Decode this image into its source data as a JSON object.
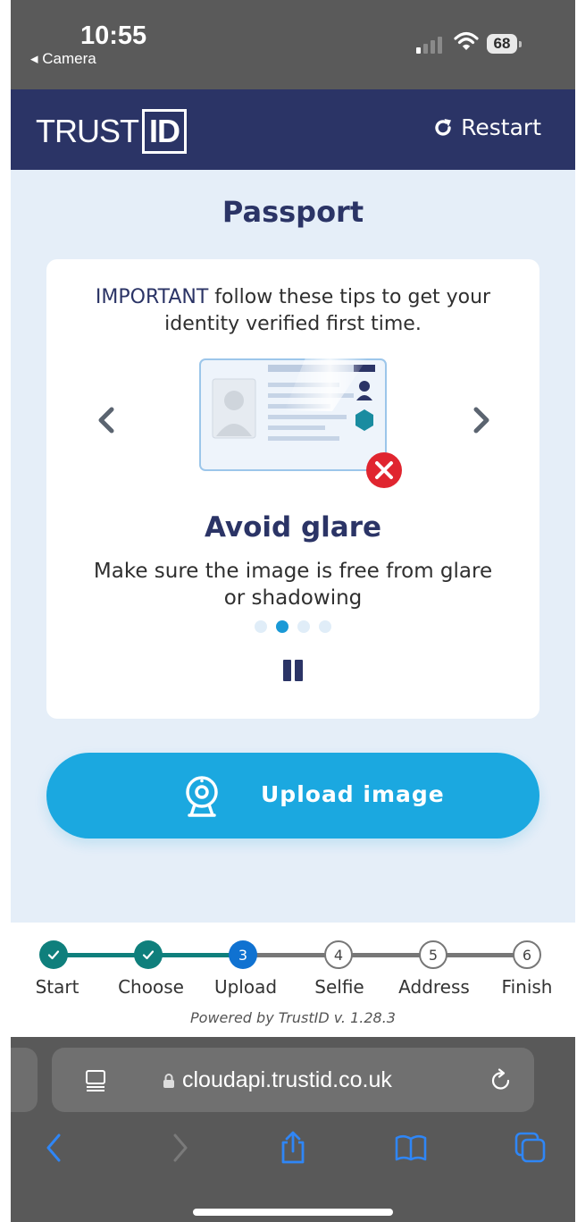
{
  "status_bar": {
    "time": "10:55",
    "back_app": "◂ Camera",
    "battery": "68"
  },
  "header": {
    "logo_prefix": "TRUST",
    "logo_box": "ID",
    "restart_label": "Restart"
  },
  "main": {
    "title": "Passport",
    "card": {
      "important_prefix": "IMPORTANT",
      "important_rest": " follow these tips to get your identity verified first time.",
      "tip_title": "Avoid glare",
      "tip_description": "Make sure the image is free from glare or shadowing",
      "carousel_dots_count": 4,
      "carousel_active_index": 1
    },
    "upload_button": "Upload image"
  },
  "stepper": {
    "steps": [
      {
        "number": "1",
        "label": "Start",
        "state": "done"
      },
      {
        "number": "2",
        "label": "Choose",
        "state": "done"
      },
      {
        "number": "3",
        "label": "Upload",
        "state": "current"
      },
      {
        "number": "4",
        "label": "Selfie",
        "state": "todo"
      },
      {
        "number": "5",
        "label": "Address",
        "state": "todo"
      },
      {
        "number": "6",
        "label": "Finish",
        "state": "todo"
      }
    ],
    "powered_by": "Powered by TrustID v. 1.28.3"
  },
  "browser": {
    "url": "cloudapi.trustid.co.uk"
  },
  "colors": {
    "brand_navy": "#2b3466",
    "upload_blue": "#1ba8e0",
    "step_done": "#0f7f7c",
    "step_current": "#1072d1",
    "error_red": "#e0252f",
    "ios_blue": "#2f86f6"
  },
  "icons": [
    "camera-back-icon",
    "signal-icon",
    "wifi-icon",
    "restart-icon",
    "chevron-left-icon",
    "chevron-right-icon",
    "glare-card-illustration",
    "error-x-icon",
    "pause-icon",
    "webcam-icon",
    "check-icon",
    "reader-icon",
    "lock-icon",
    "reload-icon",
    "back-icon",
    "forward-icon",
    "share-icon",
    "bookmarks-icon",
    "tabs-icon"
  ]
}
